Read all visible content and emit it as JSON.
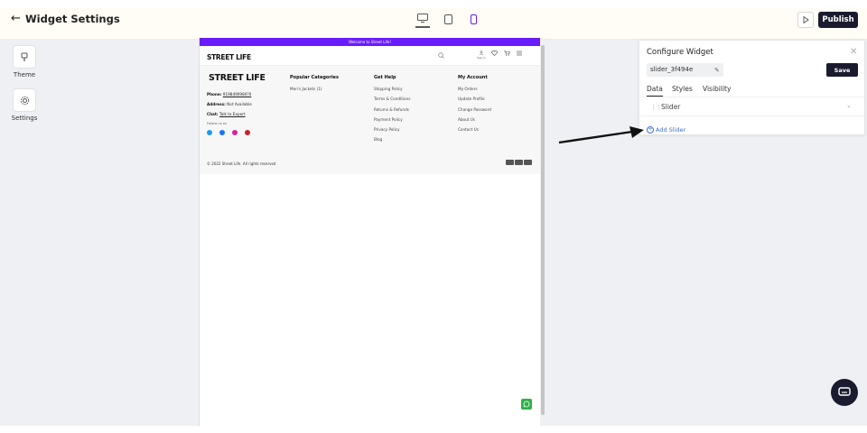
{
  "app": {
    "title": "Widget Settings",
    "publish_label": "Publish"
  },
  "rail": {
    "theme_label": "Theme",
    "settings_label": "Settings"
  },
  "preview": {
    "announcement": "Welcome to Street Life!",
    "logo": "STREET LIFE",
    "signin_label": "Sign In",
    "footer": {
      "logo": "STREET LIFE",
      "phone_label": "Phone:",
      "phone_value": "9198490984?0",
      "address_label": "Address:",
      "address_value": "Not Available",
      "chat_label": "Chat:",
      "chat_value": "Talk to Expert",
      "follow_label": "Follow us on",
      "columns": [
        {
          "heading": "Popular Categories",
          "items": [
            "Men's Jackets (1)"
          ]
        },
        {
          "heading": "Get Help",
          "items": [
            "Shipping Policy",
            "Terms & Conditions",
            "Returns & Refunds",
            "Payment Policy",
            "Privacy Policy",
            "Blog"
          ]
        },
        {
          "heading": "My Account",
          "items": [
            "My Orders",
            "Update Profile",
            "Change Password",
            "About Us",
            "Contact Us"
          ]
        }
      ],
      "copyright": "© 2022 Street Life. All rights reserved"
    }
  },
  "config": {
    "title": "Configure Widget",
    "widget_name": "slider_3f494e",
    "save_label": "Save",
    "tabs": [
      "Data",
      "Styles",
      "Visibility"
    ],
    "row_label": "Slider",
    "add_label": "Add Slider"
  },
  "colors": {
    "accent_purple": "#6a1bff",
    "dark": "#1b1b2f",
    "link_blue": "#3a6fd8",
    "whatsapp": "#2fb14a"
  }
}
